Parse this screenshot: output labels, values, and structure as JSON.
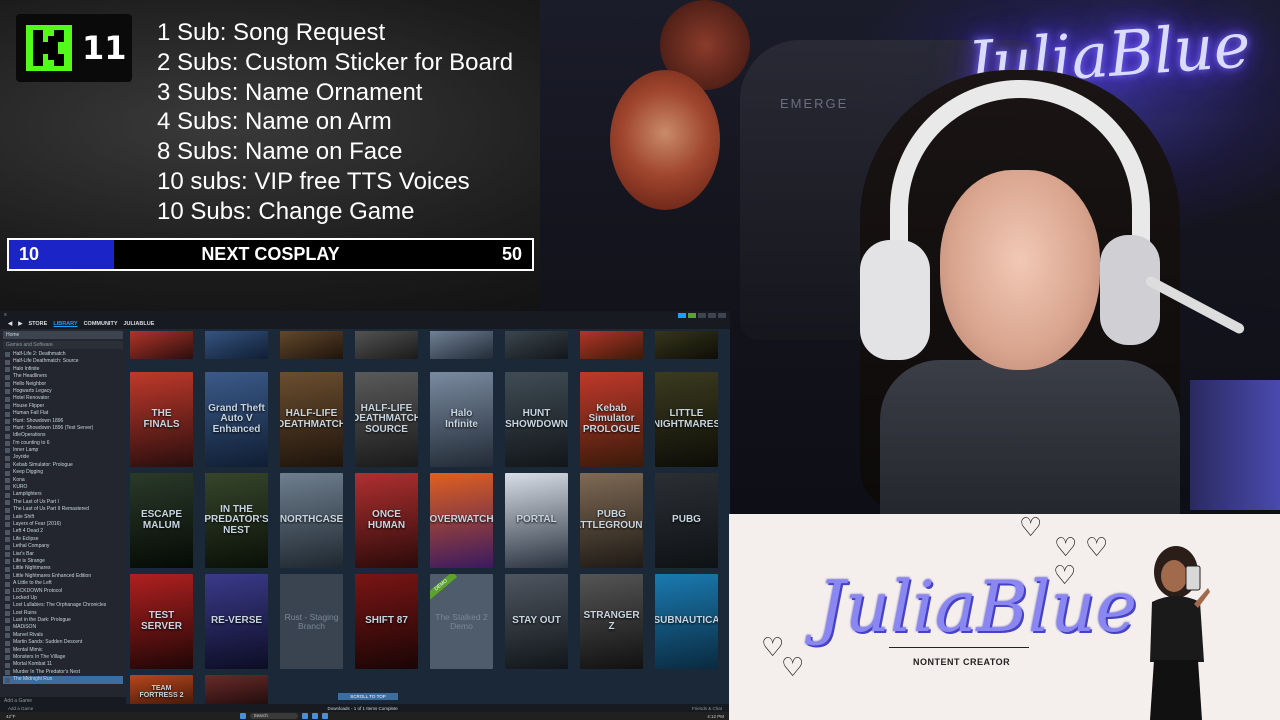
{
  "kick": {
    "logo": "kick-logo",
    "count": "11"
  },
  "goals": [
    "1 Sub: Song Request",
    "2 Subs: Custom Sticker for Board",
    "3 Subs: Name Ornament",
    "4 Subs: Name on Arm",
    "8 Subs: Name on Face",
    "10 subs: VIP free TTS Voices",
    "10 Subs: Change Game"
  ],
  "goal_bar": {
    "current": "10",
    "label": "NEXT COSPLAY",
    "target": "50",
    "progress": 0.2,
    "fill_color": "#1a24c7"
  },
  "webcam": {
    "neon_sign": "JuliaBlue",
    "chair_brand": "EMERGE"
  },
  "steam": {
    "nav": {
      "store": "STORE",
      "library": "LIBRARY",
      "community": "COMMUNITY",
      "user": "JULIABLUE"
    },
    "sidebar": {
      "home": "Home",
      "filter": "Games and Software",
      "games": [
        "Half-Life 2: Deathmatch",
        "Half-Life Deathmatch: Source",
        "Halo Infinite",
        "The Headliners",
        "Hello Neighbor",
        "Hogwarts Legacy",
        "Hotel Renovator",
        "House Flipper",
        "Human Fall Flat",
        "Hunt: Showdown 1896",
        "Hunt: Showdown 1896 (Test Server)",
        "IdleOperations",
        "I'm counting to 6",
        "Inner Lamp",
        "Joyride",
        "Kebab Simulator: Prologue",
        "Keep Digging",
        "Kona",
        "KURO",
        "Lamplighters",
        "The Last of Us Part I",
        "The Last of Us Part II Remastered",
        "Late Shift",
        "Layers of Fear (2016)",
        "Left 4 Dead 2",
        "Life Eclipse",
        "Lethal Company",
        "Liar's Bar",
        "Life is Strange",
        "Little Nightmares",
        "Little Nightmares Enhanced Edition",
        "A Little to the Left",
        "LOCKDOWN Protocol",
        "Locked Up",
        "Lost Lullabies: The Orphanage Chronicles",
        "Lost Ruins",
        "Lust in the Dark: Prologue",
        "MADiSON",
        "Marvel Rivals",
        "Martin Sands: Sudden Descent",
        "Mental Mimic",
        "Monsters In The Village",
        "Mortal Kombat 11",
        "Murder In The Predator's Nest",
        "The Midnight Run"
      ],
      "selected": "The Midnight Run",
      "add_game": "Add a Game"
    },
    "grid": {
      "top_row": [
        "",
        "",
        "",
        "",
        "",
        "",
        "",
        ""
      ],
      "rows": [
        [
          "THE FINALS",
          "Grand Theft Auto V Enhanced",
          "HALF-LIFE DEATHMATCH",
          "HALF-LIFE DEATHMATCH SOURCE",
          "Halo Infinite",
          "HUNT SHOWDOWN",
          "Kebab Simulator PROLOGUE",
          "LITTLE NIGHTMARES"
        ],
        [
          "ESCAPE MALUM",
          "IN THE PREDATOR'S NEST",
          "NORTHCASE",
          "ONCE HUMAN",
          "OVERWATCH",
          "PORTAL",
          "PUBG BATTLEGROUNDS",
          "PUBG"
        ],
        [
          "TEST SERVER",
          "RE-VERSE",
          "Rust - Staging Branch",
          "SHIFT 87",
          "The Stalked 2 Demo",
          "STAY OUT",
          "STRANGER Z",
          "SUBNAUTICA"
        ]
      ],
      "partial_bottom": "TEAM FORTRESS 2",
      "demo_badge": "DEMO",
      "scroll_to_top": "SCROLL TO TOP"
    },
    "bottom": {
      "add_game": "Add a Game",
      "downloads": "Downloads - 1 of 1 Items Complete",
      "friends": "Friends & Chat"
    },
    "taskbar": {
      "search": "Search",
      "time": "4:12 PM",
      "weather": "42°F"
    }
  },
  "banner": {
    "brand": "JuliaBlue",
    "tagline": "NONTENT CREATOR"
  },
  "colors": {
    "accent": "#1a9fff",
    "steam_bg": "#1b2838",
    "kick_green": "#53fc18"
  }
}
